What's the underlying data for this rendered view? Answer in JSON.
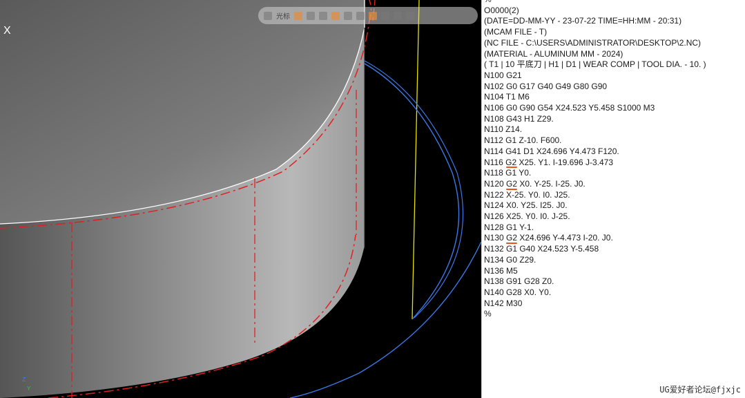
{
  "viewport": {
    "axis_label": "X",
    "triad": {
      "z": "Z",
      "y": "Y"
    },
    "toolbar": {
      "label": "光标"
    },
    "colors": {
      "background": "#000000",
      "part_face": "#8a8a8a",
      "toolpath_red": "#e02020",
      "circle_blue": "#3b78e7",
      "line_yellow": "#e6e600",
      "edge_white": "#ffffff"
    }
  },
  "nc_program": {
    "lines": [
      "%",
      "O0000(2)",
      "(DATE=DD-MM-YY - 23-07-22 TIME=HH:MM - 20:31)",
      "(MCAM FILE - T)",
      "(NC FILE - C:\\USERS\\ADMINISTRATOR\\DESKTOP\\2.NC)",
      "(MATERIAL - ALUMINUM MM - 2024)",
      "( T1 | 10 平底刀 | H1 | D1 | WEAR COMP | TOOL DIA. - 10. )",
      "N100 G21",
      "N102 G0 G17 G40 G49 G80 G90",
      "N104 T1 M6",
      "N106 G0 G90 G54 X24.523 Y5.458 S1000 M3",
      "N108 G43 H1 Z29.",
      "N110 Z14.",
      "N112 G1 Z-10. F600.",
      "N114 G41 D1 X24.696 Y4.473 F120.",
      "N116 G2 X25. Y1. I-19.696 J-3.473",
      "N118 G1 Y0.",
      "N120 G2 X0. Y-25. I-25. J0.",
      "N122 X-25. Y0. I0. J25.",
      "N124 X0. Y25. I25. J0.",
      "N126 X25. Y0. I0. J-25.",
      "N128 G1 Y-1.",
      "N130 G2 X24.696 Y-4.473 I-20. J0.",
      "N132 G1 G40 X24.523 Y-5.458",
      "N134 G0 Z29.",
      "N136 M5",
      "N138 G91 G28 Z0.",
      "N140 G28 X0. Y0.",
      "N142 M30",
      "%"
    ],
    "highlight_color": "#e8531a"
  },
  "watermark": "UG爱好者论坛@fjxjc"
}
